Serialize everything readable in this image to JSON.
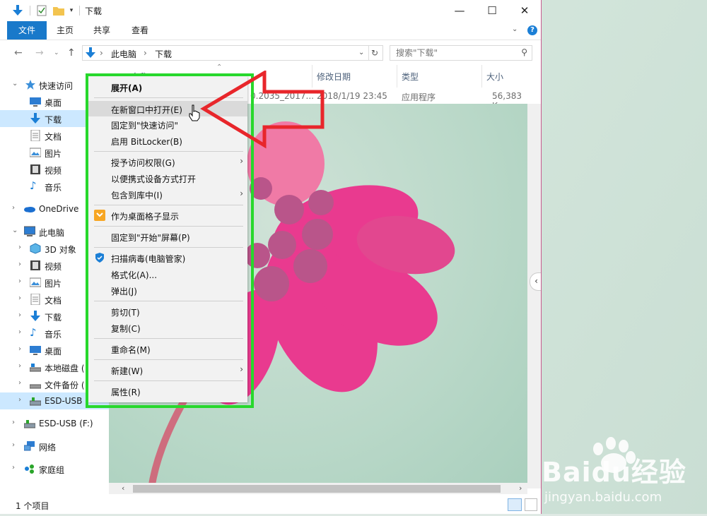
{
  "window": {
    "title": "下载",
    "controls": [
      "minimize",
      "maximize",
      "close"
    ]
  },
  "ribbon": {
    "tabs": [
      "文件",
      "主页",
      "共享",
      "查看"
    ]
  },
  "address": {
    "breadcrumb": [
      "此电脑",
      "下载"
    ],
    "search_placeholder": "搜索\"下载\""
  },
  "sidebar": {
    "items": [
      {
        "label": "快速访问",
        "icon": "star-icon",
        "expanded": true
      },
      {
        "label": "桌面",
        "icon": "desktop-icon"
      },
      {
        "label": "下载",
        "icon": "download-icon",
        "selected": true
      },
      {
        "label": "文档",
        "icon": "document-icon"
      },
      {
        "label": "图片",
        "icon": "picture-icon"
      },
      {
        "label": "视频",
        "icon": "video-icon"
      },
      {
        "label": "音乐",
        "icon": "music-icon"
      },
      {
        "label": "OneDrive",
        "icon": "cloud-icon"
      },
      {
        "label": "此电脑",
        "icon": "computer-icon",
        "expanded": true
      },
      {
        "label": "3D 对象",
        "icon": "cube-icon"
      },
      {
        "label": "视频",
        "icon": "video-icon"
      },
      {
        "label": "图片",
        "icon": "picture-icon"
      },
      {
        "label": "文档",
        "icon": "document-icon"
      },
      {
        "label": "下载",
        "icon": "download-icon"
      },
      {
        "label": "音乐",
        "icon": "music-icon"
      },
      {
        "label": "桌面",
        "icon": "desktop-icon"
      },
      {
        "label": "本地磁盘 (",
        "icon": "drive-icon"
      },
      {
        "label": "文件备份 (",
        "icon": "drive-icon"
      },
      {
        "label": "ESD-USB (",
        "icon": "usb-icon"
      },
      {
        "label": "ESD-USB (F:)",
        "icon": "usb-icon"
      },
      {
        "label": "网络",
        "icon": "network-icon"
      },
      {
        "label": "家庭组",
        "icon": "homegroup-icon"
      }
    ]
  },
  "columns": [
    "名称",
    "修改日期",
    "类型",
    "大小"
  ],
  "file_row": {
    "name": "0.2035_2017...",
    "date": "2018/1/19 23:45",
    "type": "应用程序",
    "size": "56,383 K"
  },
  "context_menu": {
    "items": [
      {
        "label": "展开(A)",
        "bold": true
      },
      {
        "label": "在新窗口中打开(E)",
        "hover": true
      },
      {
        "label": "固定到\"快速访问\""
      },
      {
        "label": "启用 BitLocker(B)"
      },
      {
        "label": "授予访问权限(G)",
        "submenu": true
      },
      {
        "label": "以便携式设备方式打开"
      },
      {
        "label": "包含到库中(I)",
        "submenu": true
      },
      {
        "label": "作为桌面格子显示",
        "icon": "grid-icon"
      },
      {
        "label": "固定到\"开始\"屏幕(P)"
      },
      {
        "label": "扫描病毒(电脑管家)",
        "icon": "shield-icon"
      },
      {
        "label": "格式化(A)..."
      },
      {
        "label": "弹出(J)"
      },
      {
        "label": "剪切(T)"
      },
      {
        "label": "复制(C)"
      },
      {
        "label": "重命名(M)"
      },
      {
        "label": "新建(W)",
        "submenu": true
      },
      {
        "label": "属性(R)"
      }
    ]
  },
  "status": {
    "count": "1 个项目"
  },
  "watermark": {
    "brand": "Baidu经验",
    "url": "jingyan.baidu.com"
  },
  "colors": {
    "accent": "#1979ca",
    "highlight_box": "#27d82c",
    "arrow": "#e8262b",
    "selected": "#cce8ff"
  }
}
